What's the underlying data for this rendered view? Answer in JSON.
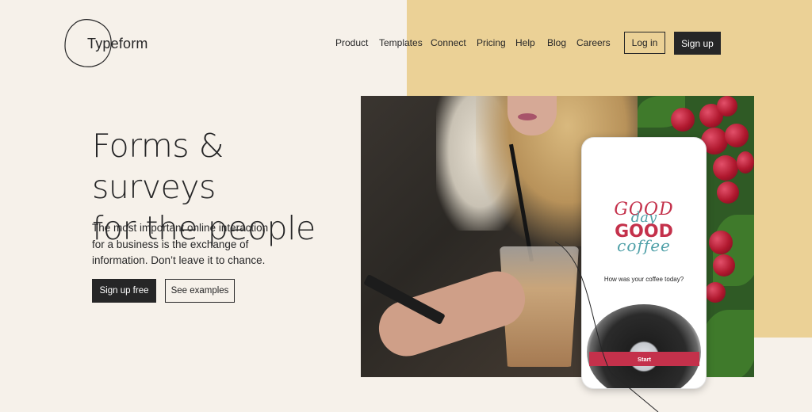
{
  "brand": {
    "name": "Typeform"
  },
  "nav": {
    "items": [
      "Product",
      "Templates",
      "Connect",
      "Pricing",
      "Help",
      "Blog",
      "Careers"
    ],
    "login": "Log in",
    "signup": "Sign up"
  },
  "hero": {
    "title_line1": "Forms & surveys",
    "title_line2": "for the people",
    "sub_line1": "The most important online interaction",
    "sub_line2": "for a business is the exchange of",
    "sub_line3": "information. Don’t leave it to chance.",
    "cta_primary": "Sign up free",
    "cta_secondary": "See examples"
  },
  "mockup": {
    "good_top": "GOOD",
    "day": "day",
    "good_mid": "GOOD",
    "coffee": "coffee",
    "question": "How was your coffee today?",
    "start": "Start"
  },
  "colors": {
    "background": "#f6f1ea",
    "accent_yellow": "#ebd196",
    "dark": "#262627",
    "brand_red": "#c4314b",
    "teal": "#4fa0a8"
  }
}
